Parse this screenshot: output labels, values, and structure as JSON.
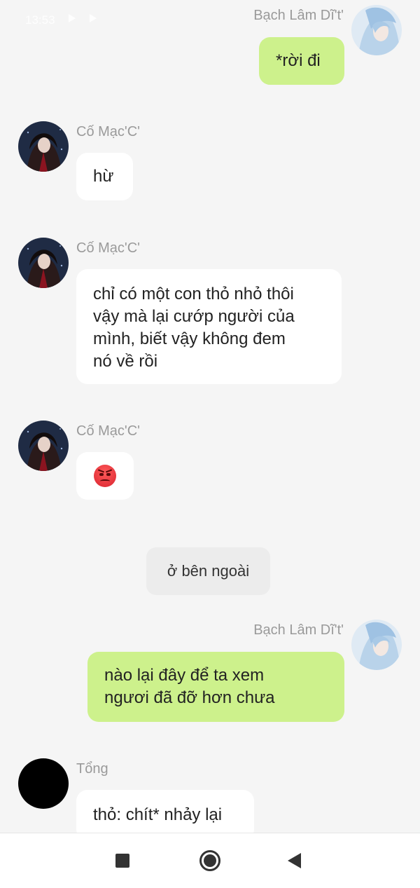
{
  "status_bar": {
    "time": "13:53"
  },
  "messages": [
    {
      "sender": "Bạch Lâm Dĩ't'",
      "side": "right",
      "lines": [
        "*rời đi"
      ]
    },
    {
      "sender": "Cố Mạc'C'",
      "side": "left",
      "lines": [
        "hừ"
      ]
    },
    {
      "sender": "Cố Mạc'C'",
      "side": "left",
      "lines": [
        "chỉ có một con thỏ nhỏ thôi",
        "vậy mà lại cướp người của",
        "mình, biết vậy không đem",
        "nó về rồi"
      ]
    },
    {
      "sender": "Cố Mạc'C'",
      "side": "left",
      "emoji": "angry-face"
    },
    {
      "sender": "Bạch Lâm Dĩ't'",
      "side": "right",
      "lines": [
        "nào lại đây để ta xem",
        "ngươi đã đỡ hơn chưa"
      ]
    },
    {
      "sender": "Tổng",
      "side": "left",
      "lines": [
        "thỏ: chít* nhảy lại"
      ]
    }
  ],
  "center_notice": "ở bên ngoài",
  "colors": {
    "background": "#f5f5f5",
    "bubble_self": "#cdf18c",
    "bubble_other": "#ffffff",
    "name_text": "#9a9a9a"
  },
  "nav_bar": {
    "icons": [
      "recent-apps-icon",
      "home-icon",
      "back-icon"
    ]
  }
}
